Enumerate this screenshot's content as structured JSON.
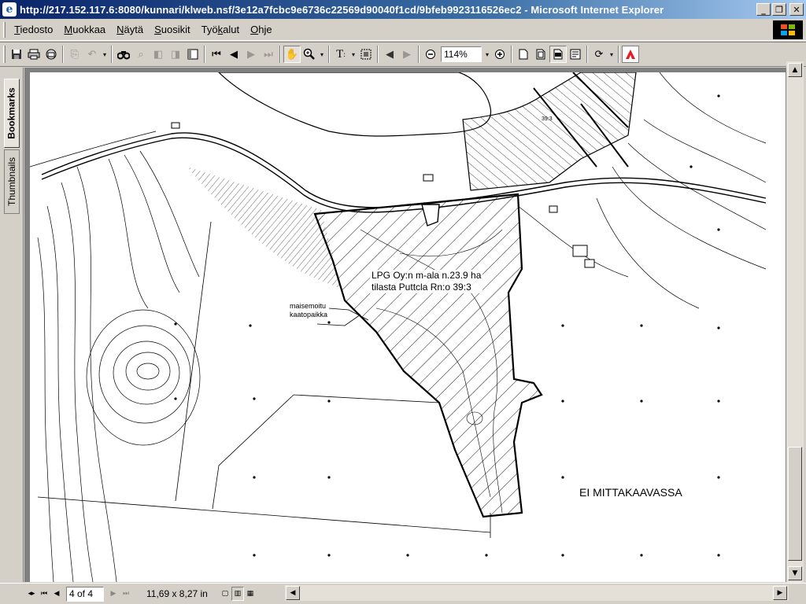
{
  "window": {
    "title": "http://217.152.117.6:8080/kunnari/klweb.nsf/3e12a7fcbc9e6736c22569d90040f1cd/9bfeb9923116526ec2 - Microsoft Internet Explorer",
    "icon": "ie-icon",
    "minimize": "_",
    "restore": "❐",
    "close": "✕"
  },
  "menu": {
    "items": [
      {
        "pre": "",
        "ul": "T",
        "post": "iedosto"
      },
      {
        "pre": "",
        "ul": "M",
        "post": "uokkaa"
      },
      {
        "pre": "",
        "ul": "N",
        "post": "äytä"
      },
      {
        "pre": "",
        "ul": "S",
        "post": "uosikit"
      },
      {
        "pre": "Työ",
        "ul": "k",
        "post": "alut"
      },
      {
        "pre": "",
        "ul": "O",
        "post": "hje"
      }
    ]
  },
  "toolbar": {
    "zoom_value": "114%"
  },
  "side_tabs": {
    "bookmarks": "Bookmarks",
    "thumbnails": "Thumbnails"
  },
  "map": {
    "label_line1": "LPG Oy:n m-ala n.23.9 ha",
    "label_line2": "tilasta Puttcla Rn:o 39:3",
    "small_line1": "maisemoitu",
    "small_line2": "kaatopaikka",
    "scale_note": "EI MITTAKAAVASSA",
    "parcel_number": "39:3"
  },
  "status": {
    "page_indicator": "4 of 4",
    "page_size": "11,69 x 8,27 in"
  },
  "colors": {
    "titlebar_start": "#0a246a",
    "chrome": "#d4d0c8",
    "doc_background": "#808080"
  }
}
